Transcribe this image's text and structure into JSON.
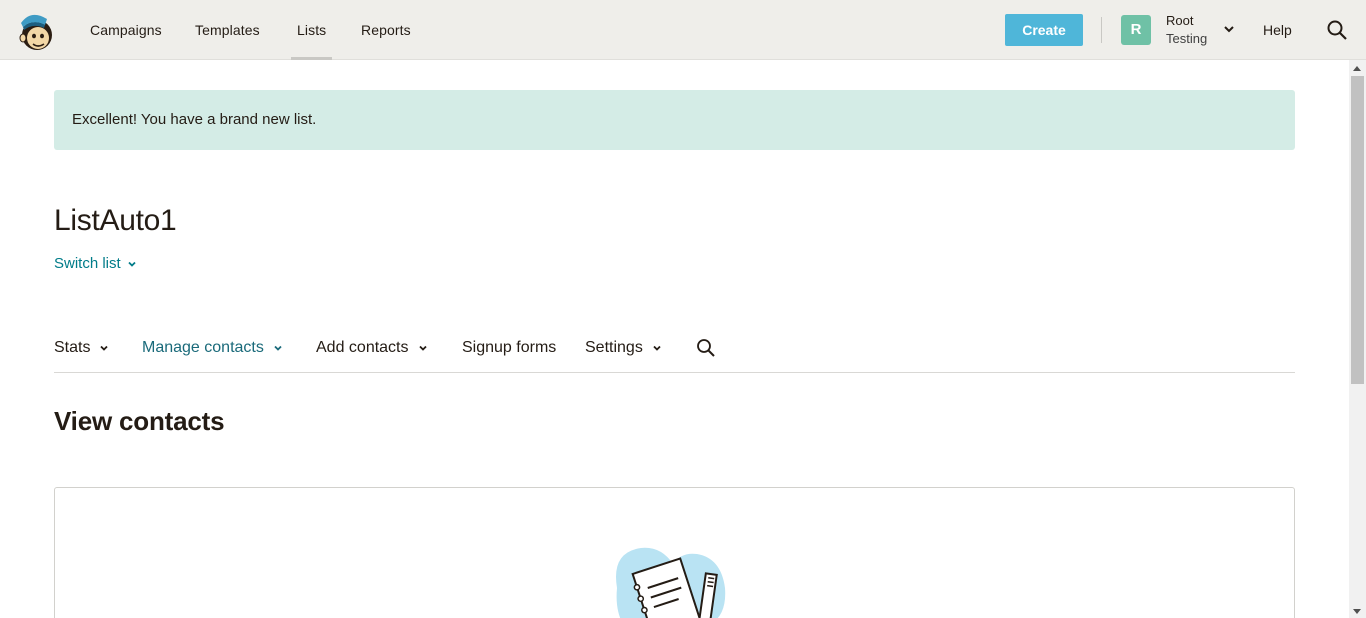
{
  "nav": {
    "items": [
      {
        "label": "Campaigns"
      },
      {
        "label": "Templates"
      },
      {
        "label": "Lists"
      },
      {
        "label": "Reports"
      }
    ],
    "active": "Lists",
    "create_label": "Create",
    "account": {
      "avatar_letter": "R",
      "name": "Root",
      "org": "Testing"
    },
    "help_label": "Help"
  },
  "alert": {
    "message": "Excellent! You have a brand new list."
  },
  "list": {
    "title": "ListAuto1",
    "switch_label": "Switch list"
  },
  "subnav": {
    "items": [
      {
        "label": "Stats"
      },
      {
        "label": "Manage contacts"
      },
      {
        "label": "Add contacts"
      },
      {
        "label": "Signup forms"
      },
      {
        "label": "Settings"
      }
    ],
    "active": "Manage contacts"
  },
  "section": {
    "title": "View contacts"
  },
  "colors": {
    "accent": "#4fb6d9",
    "link": "#007c89",
    "alert_bg": "#d4ece6",
    "avatar_bg": "#6fc1a6"
  },
  "icons": [
    "mailchimp-logo",
    "chevron-down-icon",
    "search-icon",
    "notebook-pencil-illustration"
  ]
}
